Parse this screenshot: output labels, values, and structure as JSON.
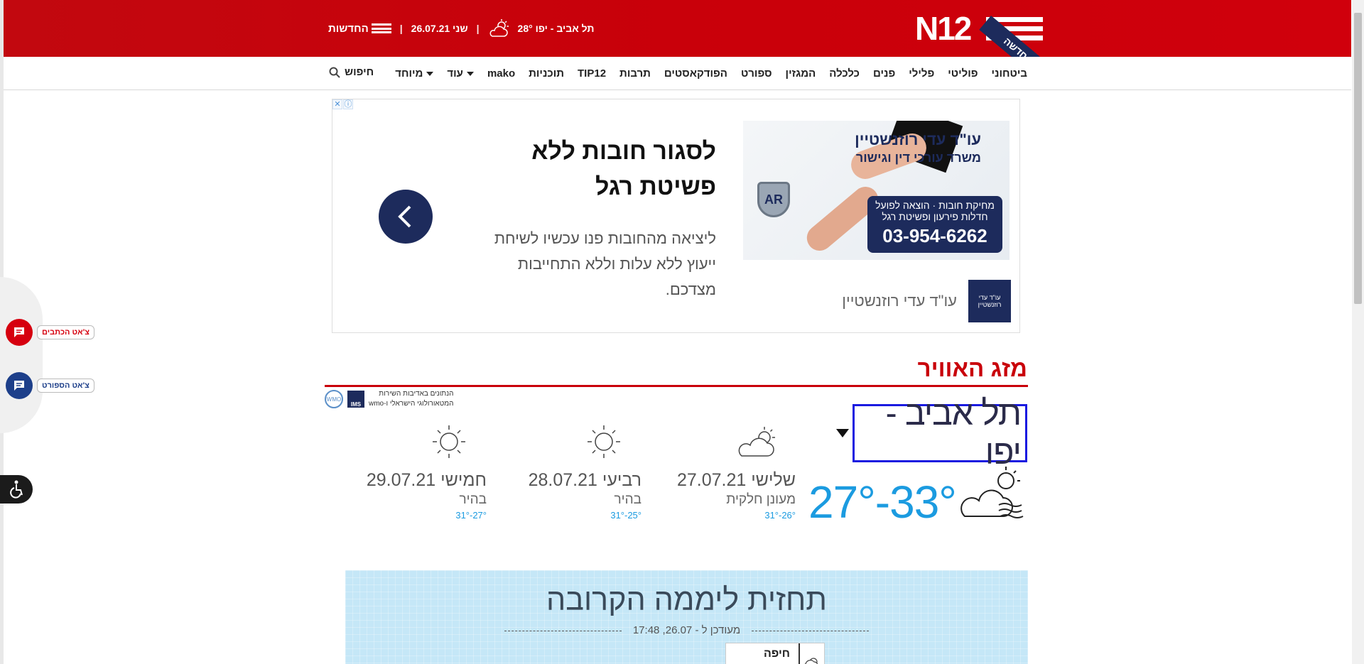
{
  "header": {
    "logo": "N12",
    "ribbon": "גרסה חדשה",
    "location_temp": "תל אביב - יפו 28°",
    "date": "שני 26.07.21",
    "news_label": "החדשות"
  },
  "nav": {
    "items": [
      {
        "label": "ביטחוני"
      },
      {
        "label": "פוליטי"
      },
      {
        "label": "פלילי"
      },
      {
        "label": "פנים"
      },
      {
        "label": "כלכלה"
      },
      {
        "label": "המגזין"
      },
      {
        "label": "ספורט"
      },
      {
        "label": "הפודקאסטים"
      },
      {
        "label": "תרבות"
      },
      {
        "label": "TIP12"
      },
      {
        "label": "תוכניות"
      },
      {
        "label": "mako"
      },
      {
        "label": "עוד"
      },
      {
        "label": "מיוחד"
      }
    ],
    "search_label": "חיפוש"
  },
  "side": {
    "chat_writers": "צ'אט הכתבים",
    "chat_sport": "צ'אט הספורט"
  },
  "ad": {
    "image_line1": "עו\"ד עדי רוזנשטיין",
    "image_line2": "משרד עורכי דין וגישור",
    "image_services": "מחיקת חובות · הוצאה לפועל",
    "image_services2": "חדלות פירעון ופשיטת רגל",
    "image_phone": "03-954-6262",
    "title": "לסגור חובות ללא פשיטת רגל",
    "description": "ליציאה מהחובות פנו עכשיו לשיחת ייעוץ ללא עלות וללא התחייבות מצדכם.",
    "advertiser": "עו\"ד עדי רוזנשטיין",
    "advertiser_logo_text": "עו\"ד עדי רוזנשטיין"
  },
  "weather": {
    "title": "מזג האוויר",
    "source_text_line1": "הנתונים באדיבות השירות",
    "source_text_line2": "המטאורולוגי הישראלי ו-wmo",
    "ims_label": "IMS",
    "wmo_label": "WMO",
    "city": "תל אביב - יפו",
    "today_range": "27°-33°",
    "days": [
      {
        "date": "שלישי 27.07.21",
        "condition": "מעונן חלקית",
        "range": "31°-26°",
        "icon": "partly-cloudy-icon"
      },
      {
        "date": "רביעי 28.07.21",
        "condition": "בהיר",
        "range": "31°-25°",
        "icon": "sun-icon"
      },
      {
        "date": "חמישי 29.07.21",
        "condition": "בהיר",
        "range": "31°-27°",
        "icon": "sun-icon"
      }
    ],
    "forecast_title": "תחזית ליממה הקרובה",
    "forecast_updated": "מעודכן ל - 26.07, 17:48",
    "forecast_city": "חיפה"
  },
  "colors": {
    "brand_red": "#c9000a",
    "navy": "#1d2b5c",
    "temp_blue": "#1b9be0",
    "city_focus_border": "#1a1ae0"
  }
}
